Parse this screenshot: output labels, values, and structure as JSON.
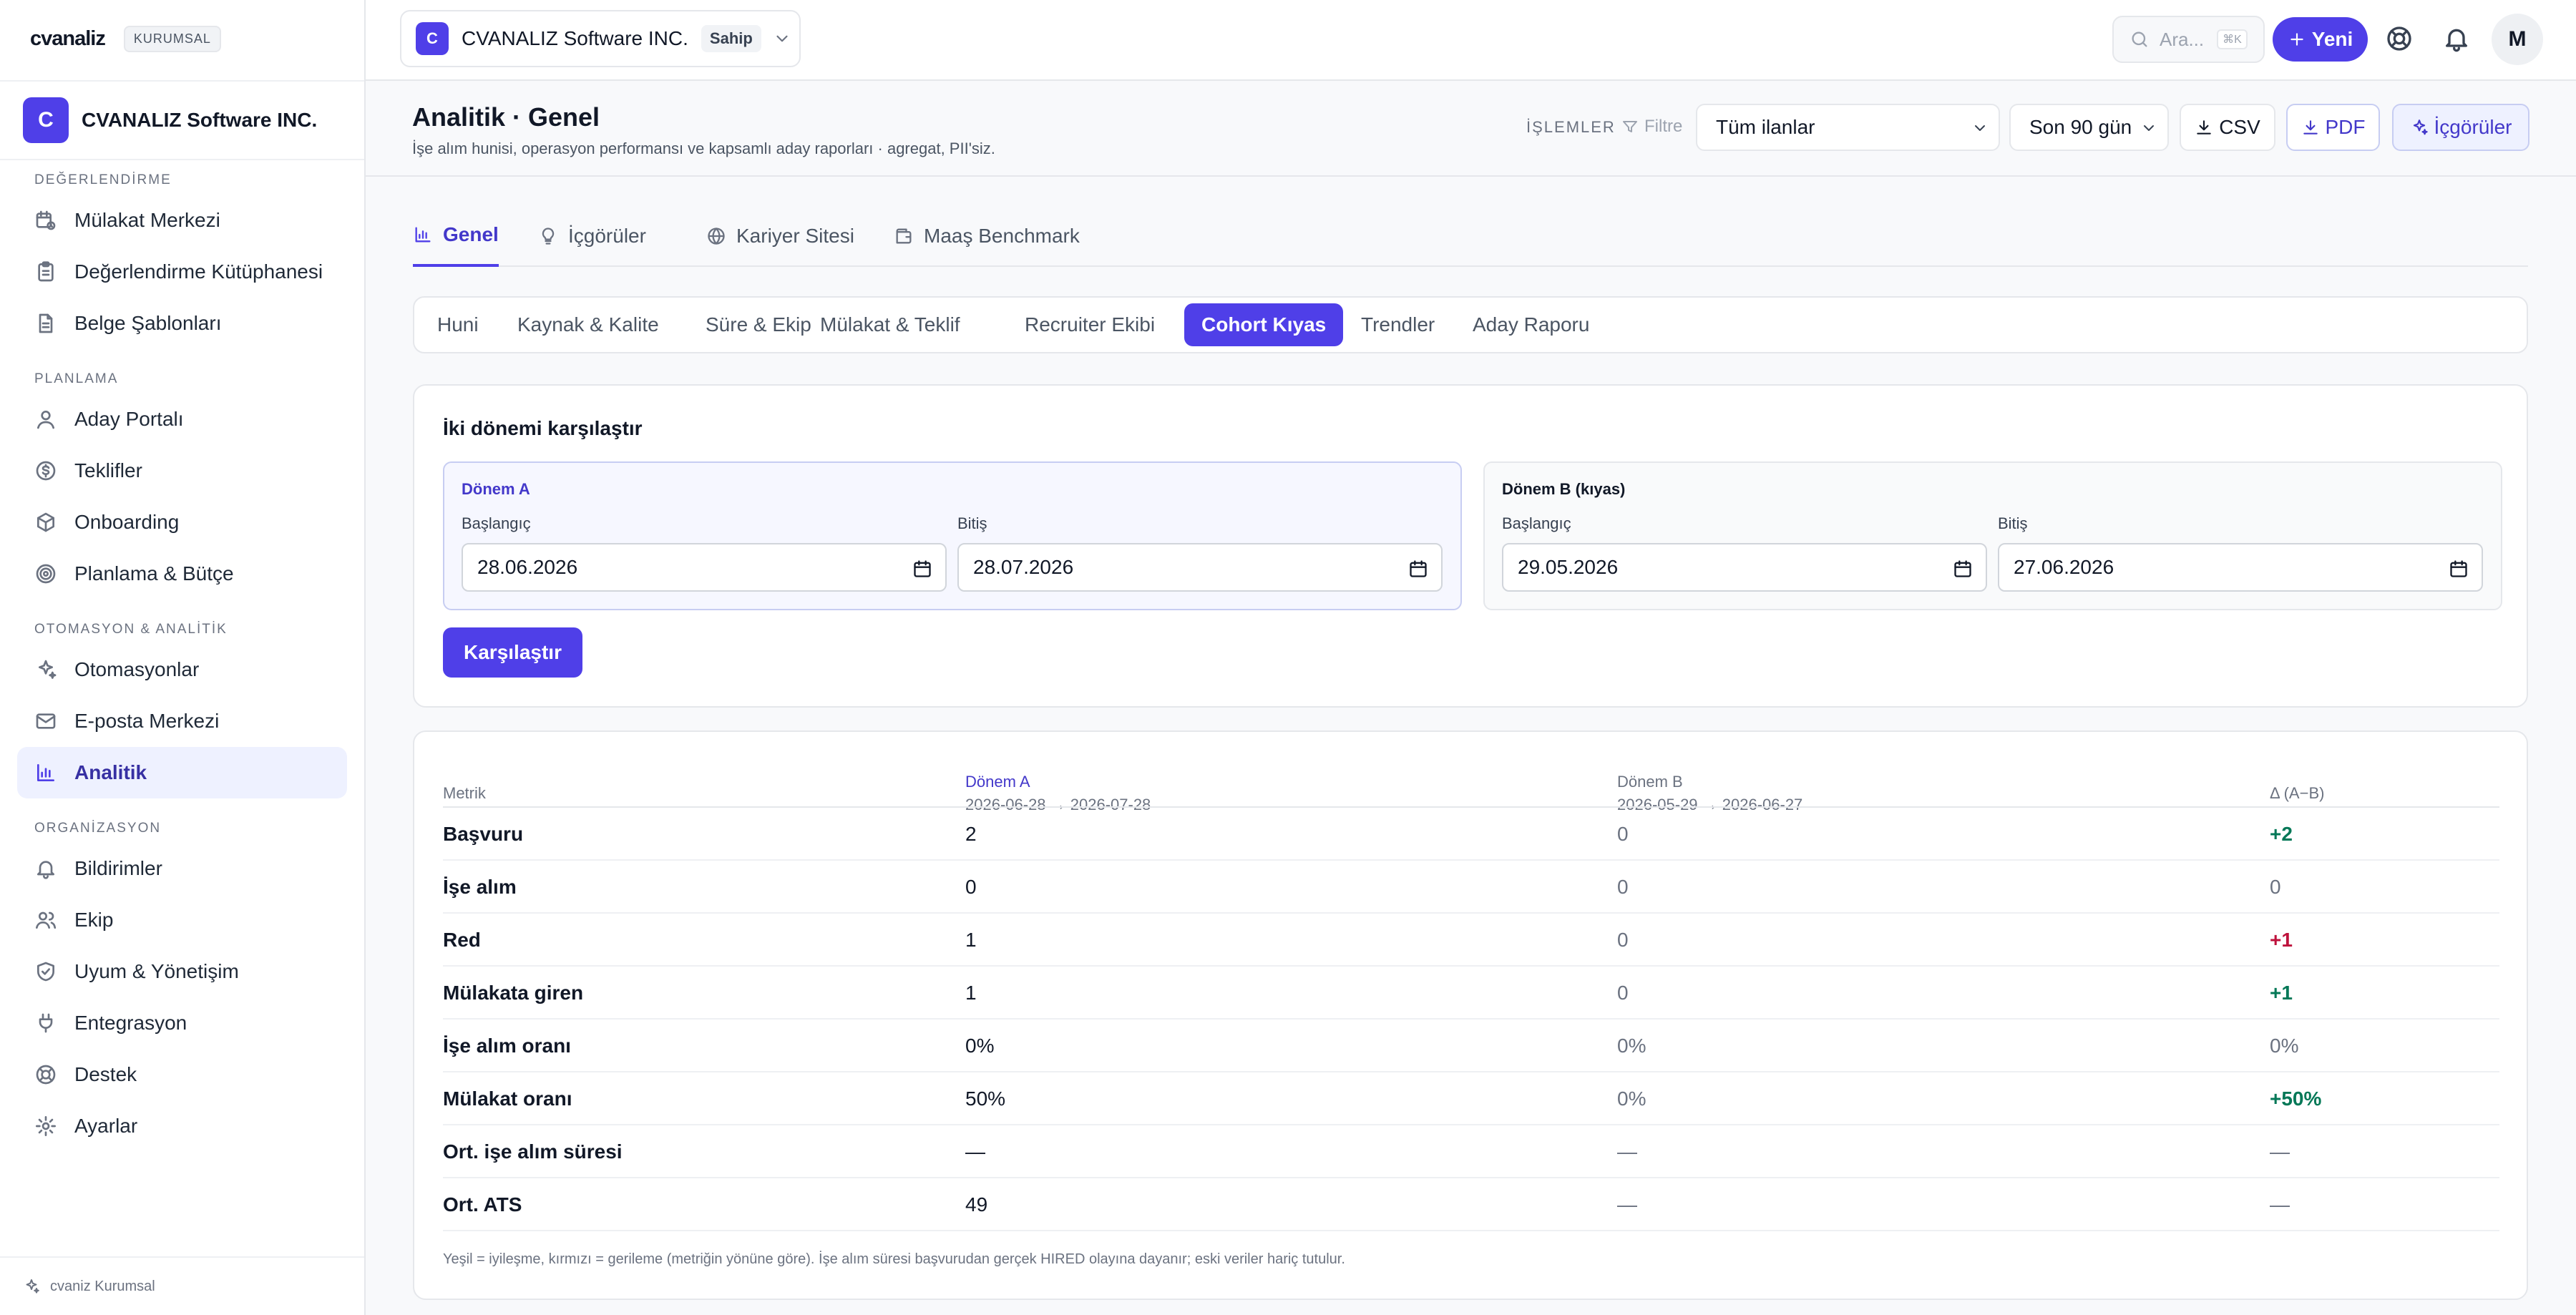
{
  "brand": {
    "logo": "cvanaliz",
    "badge": "KURUMSAL"
  },
  "workspace": {
    "initial": "C",
    "name": "CVANALIZ Software INC.",
    "role": "Sahip"
  },
  "sidebar": {
    "sections": [
      {
        "title": "DEĞERLENDİRME",
        "items": [
          {
            "label": "Mülakat Merkezi",
            "icon": "calendar-clock-icon"
          },
          {
            "label": "Değerlendirme Kütüphanesi",
            "icon": "clipboard-icon"
          },
          {
            "label": "Belge Şablonları",
            "icon": "file-text-icon"
          }
        ]
      },
      {
        "title": "PLANLAMA",
        "items": [
          {
            "label": "Aday Portalı",
            "icon": "user-icon"
          },
          {
            "label": "Teklifler",
            "icon": "dollar-circle-icon"
          },
          {
            "label": "Onboarding",
            "icon": "package-icon"
          },
          {
            "label": "Planlama & Bütçe",
            "icon": "target-icon"
          }
        ]
      },
      {
        "title": "OTOMASYON & ANALİTİK",
        "items": [
          {
            "label": "Otomasyonlar",
            "icon": "sparkles-icon"
          },
          {
            "label": "E-posta Merkezi",
            "icon": "mail-icon"
          },
          {
            "label": "Analitik",
            "icon": "bar-chart-icon",
            "active": true
          }
        ]
      },
      {
        "title": "ORGANİZASYON",
        "items": [
          {
            "label": "Bildirimler",
            "icon": "bell-icon"
          },
          {
            "label": "Ekip",
            "icon": "users-icon"
          },
          {
            "label": "Uyum & Yönetişim",
            "icon": "shield-check-icon"
          },
          {
            "label": "Entegrasyon",
            "icon": "plug-icon"
          },
          {
            "label": "Destek",
            "icon": "lifebuoy-icon"
          },
          {
            "label": "Ayarlar",
            "icon": "gear-icon"
          }
        ]
      }
    ],
    "footer": "cvaniz Kurumsal"
  },
  "topbar": {
    "search_placeholder": "Ara...",
    "search_shortcut": "⌘K",
    "new_label": "Yeni",
    "user_initial": "M"
  },
  "page": {
    "title": "Analitik · Genel",
    "subtitle": "İşe alım hunisi, operasyon performansı ve kapsamlı aday raporları · agregat, PII'siz.",
    "actions_label": "İŞLEMLER",
    "filter_label": "Filtre",
    "job_filter": "Tüm ilanlar",
    "range_filter": "Son 90 gün",
    "csv_label": "CSV",
    "pdf_label": "PDF",
    "insights_label": "İçgörüler"
  },
  "tabs": [
    {
      "label": "Genel",
      "icon": "bar-chart-icon",
      "active": true
    },
    {
      "label": "İçgörüler",
      "icon": "lightbulb-icon"
    },
    {
      "label": "Kariyer Sitesi",
      "icon": "globe-icon"
    },
    {
      "label": "Maaş Benchmark",
      "icon": "wallet-icon"
    }
  ],
  "subtabs": [
    {
      "label": "Huni"
    },
    {
      "label": "Kaynak & Kalite"
    },
    {
      "label": "Süre & Ekip"
    },
    {
      "label": "Mülakat & Teklif"
    },
    {
      "label": "Recruiter Ekibi"
    },
    {
      "label": "Cohort Kıyas",
      "active": true
    },
    {
      "label": "Trendler"
    },
    {
      "label": "Aday Raporu"
    }
  ],
  "compare": {
    "title": "İki dönemi karşılaştır",
    "period_a": {
      "label": "Dönem A",
      "start_label": "Başlangıç",
      "start": "28.06.2026",
      "end_label": "Bitiş",
      "end": "28.07.2026"
    },
    "period_b": {
      "label": "Dönem B (kıyas)",
      "start_label": "Başlangıç",
      "start": "29.05.2026",
      "end_label": "Bitiş",
      "end": "27.06.2026"
    },
    "button": "Karşılaştır"
  },
  "table": {
    "headers": {
      "metric": "Metrik",
      "a": "Dönem A",
      "a_range": "2026-06-28 → 2026-07-28",
      "b": "Dönem B",
      "b_range": "2026-05-29 → 2026-06-27",
      "delta": "Δ (A−B)"
    },
    "rows": [
      {
        "metric": "Başvuru",
        "a": "2",
        "b": "0",
        "delta": "+2",
        "tone": "pos"
      },
      {
        "metric": "İşe alım",
        "a": "0",
        "b": "0",
        "delta": "0",
        "tone": "neutral"
      },
      {
        "metric": "Red",
        "a": "1",
        "b": "0",
        "delta": "+1",
        "tone": "neg"
      },
      {
        "metric": "Mülakata giren",
        "a": "1",
        "b": "0",
        "delta": "+1",
        "tone": "pos"
      },
      {
        "metric": "İşe alım oranı",
        "a": "0%",
        "b": "0%",
        "delta": "0%",
        "tone": "neutral"
      },
      {
        "metric": "Mülakat oranı",
        "a": "50%",
        "b": "0%",
        "delta": "+50%",
        "tone": "pos"
      },
      {
        "metric": "Ort. işe alım süresi",
        "a": "—",
        "b": "—",
        "delta": "—",
        "tone": "neutral"
      },
      {
        "metric": "Ort. ATS",
        "a": "49",
        "b": "—",
        "delta": "—",
        "tone": "neutral"
      }
    ],
    "note": "Yeşil = iyileşme, kırmızı = gerileme (metriğin yönüne göre). İşe alım süresi başvurudan gerçek HIRED olayına dayanır; eski veriler hariç tutulur."
  },
  "colors": {
    "accent": "#4f3fe8",
    "positive": "#047857",
    "negative": "#be123c"
  }
}
